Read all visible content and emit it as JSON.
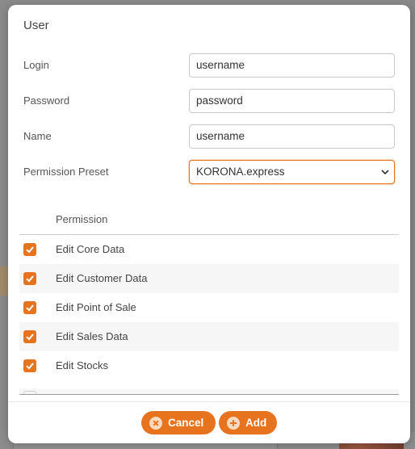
{
  "dialog": {
    "title": "User",
    "fields": {
      "login": {
        "label": "Login",
        "value": "username"
      },
      "password": {
        "label": "Password",
        "value": "password"
      },
      "name": {
        "label": "Name",
        "value": "username"
      },
      "preset": {
        "label": "Permission Preset",
        "value": "KORONA.express"
      }
    },
    "permissions": {
      "header": "Permission",
      "items": [
        {
          "label": "Edit Core Data",
          "checked": true
        },
        {
          "label": "Edit Customer Data",
          "checked": true
        },
        {
          "label": "Edit Point of Sale",
          "checked": true
        },
        {
          "label": "Edit Sales Data",
          "checked": true
        },
        {
          "label": "Edit Stocks",
          "checked": true
        }
      ]
    },
    "buttons": {
      "cancel": "Cancel",
      "add": "Add"
    }
  },
  "colors": {
    "accent": "#e8731f",
    "overlay": "#8a8a8a"
  },
  "icons": {
    "cancel": "close-circle-icon",
    "add": "plus-circle-icon",
    "select": "chevron-down-icon",
    "checkbox": "checkmark-icon"
  }
}
